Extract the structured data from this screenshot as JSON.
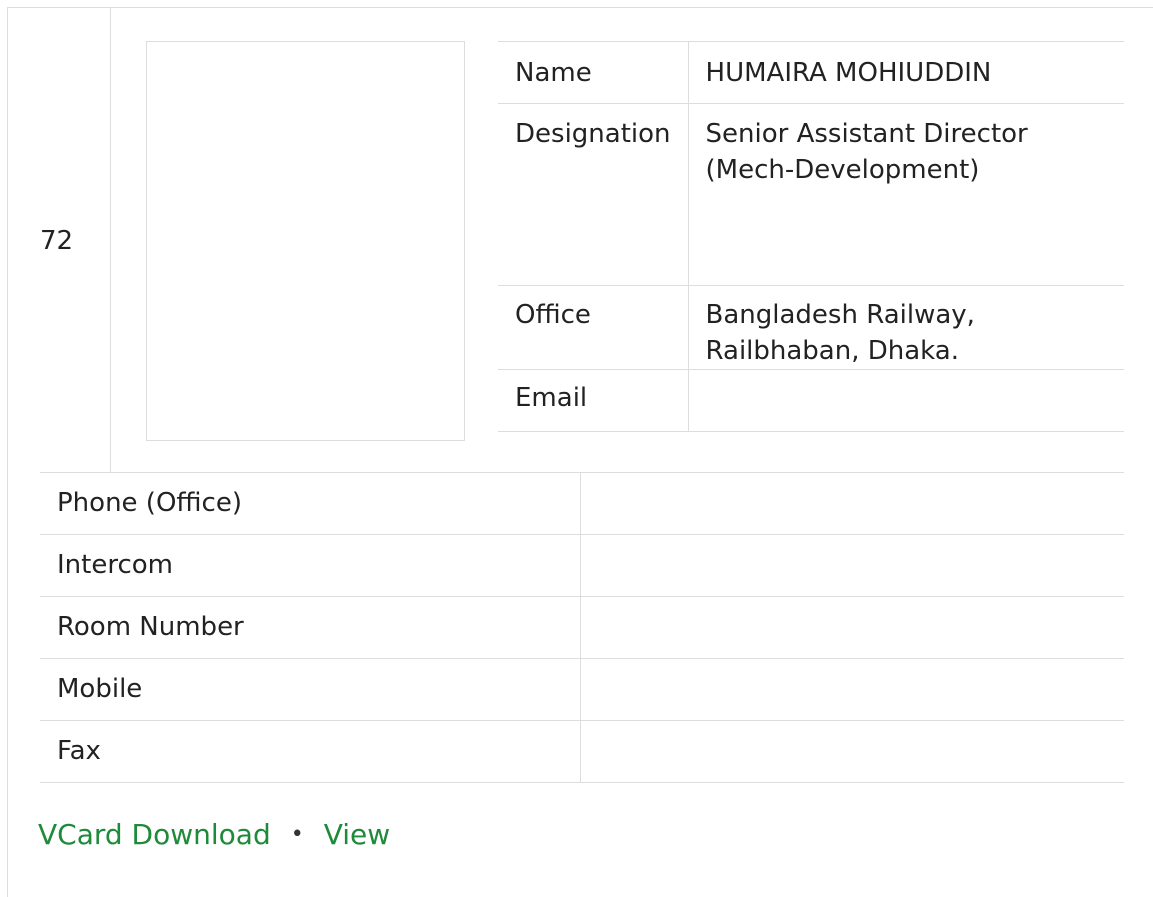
{
  "entry": {
    "serial": "72",
    "fields": [
      {
        "key": "Name",
        "value": "HUMAIRA MOHIUDDIN"
      },
      {
        "key": "Designation",
        "value": "Senior Assistant Director (Mech-Development)"
      },
      {
        "key": "Office",
        "value": "Bangladesh Railway, Railbhaban, Dhaka."
      },
      {
        "key": "Email",
        "value": ""
      }
    ],
    "contacts": [
      {
        "key": "Phone (Office)",
        "value": ""
      },
      {
        "key": "Intercom",
        "value": ""
      },
      {
        "key": "Room Number",
        "value": ""
      },
      {
        "key": "Mobile",
        "value": ""
      },
      {
        "key": "Fax",
        "value": ""
      }
    ]
  },
  "links": {
    "vcard_label": "VCard Download",
    "separator": "•",
    "view_label": "View"
  },
  "colors": {
    "link": "#1e8a3a",
    "border": "#dddddd"
  }
}
